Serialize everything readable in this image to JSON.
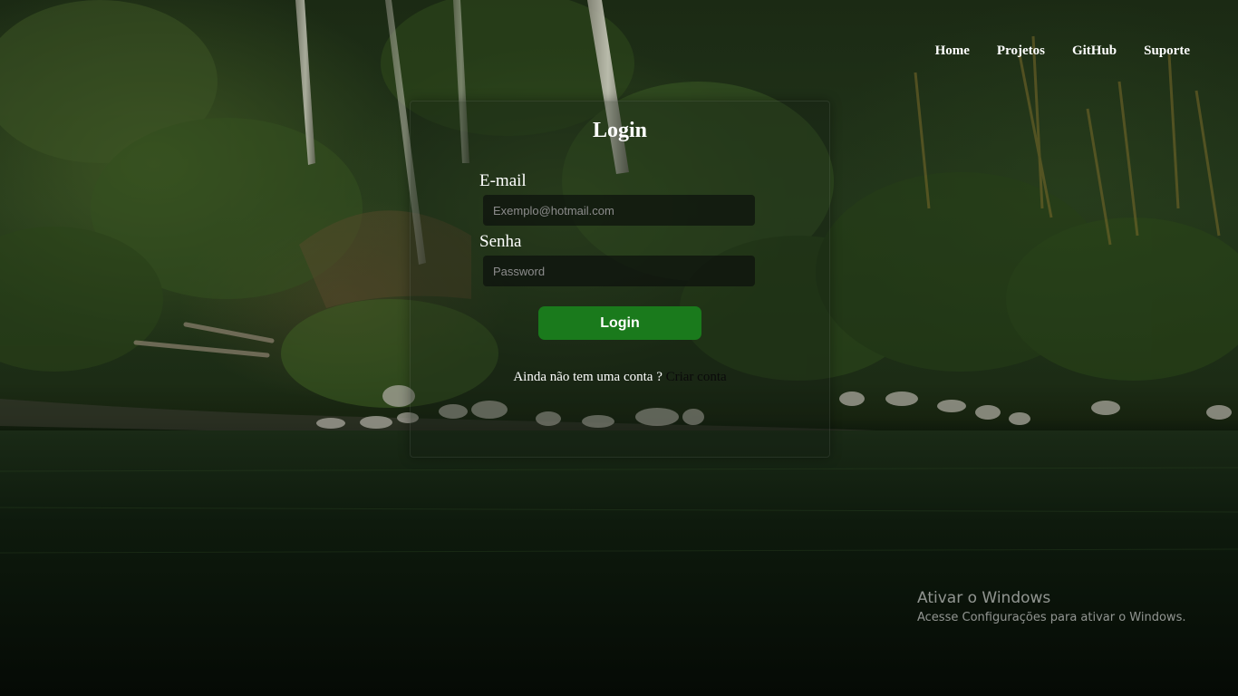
{
  "nav": {
    "items": [
      "Home",
      "Projetos",
      "GitHub",
      "Suporte"
    ]
  },
  "login": {
    "title": "Login",
    "email_label": "E-mail",
    "email_placeholder": "Exemplo@hotmail.com",
    "password_label": "Senha",
    "password_placeholder": "Password",
    "button_label": "Login",
    "signup_prompt": "Ainda não tem uma conta ?",
    "signup_link": "Criar conta"
  },
  "watermark": {
    "title": "Ativar o Windows",
    "subtitle": "Acesse Configurações para ativar o Windows."
  },
  "colors": {
    "button": "#1a7a1c",
    "link": "#0a0a0a",
    "text": "#ffffff"
  }
}
